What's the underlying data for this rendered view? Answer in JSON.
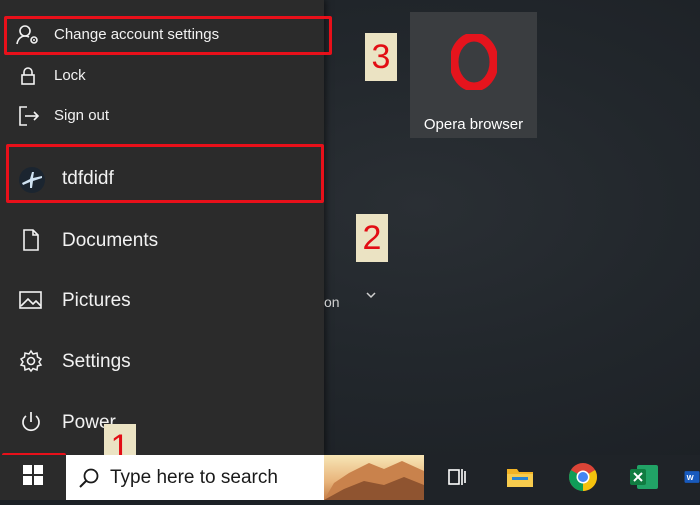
{
  "start_menu": {
    "account_items": [
      {
        "label": "Change account settings",
        "icon": "person-gear-icon"
      },
      {
        "label": "Lock",
        "icon": "lock-icon"
      },
      {
        "label": "Sign out",
        "icon": "sign-out-icon"
      }
    ],
    "user": {
      "name": "tdfdidf",
      "icon": "airplane-avatar-icon"
    },
    "places": [
      {
        "label": "Documents",
        "icon": "document-icon"
      },
      {
        "label": "Pictures",
        "icon": "pictures-icon"
      },
      {
        "label": "Settings",
        "icon": "gear-icon"
      },
      {
        "label": "Power",
        "icon": "power-icon"
      }
    ]
  },
  "tiles": {
    "opera": {
      "label": "Opera browser",
      "icon": "opera-logo-icon"
    },
    "partial_label": "on"
  },
  "annotations": {
    "step1": "1",
    "step2": "2",
    "step3": "3",
    "highlight_color": "#e8101a"
  },
  "taskbar": {
    "search_placeholder": "Type here to search",
    "apps": [
      "task-view-icon",
      "file-explorer-icon",
      "chrome-icon",
      "excel-icon",
      "word-icon"
    ]
  }
}
